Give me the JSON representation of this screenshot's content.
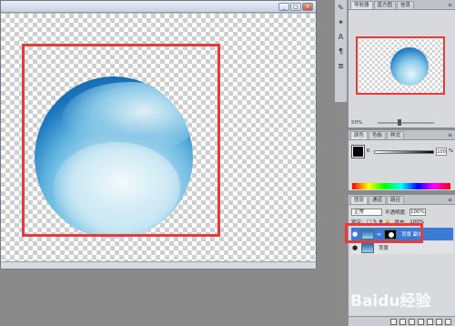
{
  "document": {
    "window_buttons": {
      "minimize": "_",
      "restore": "□",
      "close": "×"
    }
  },
  "tool_icons": [
    "brush-icon",
    "wand-icon",
    "text-icon",
    "paragraph-icon",
    "layers-small-icon"
  ],
  "navigator_panel": {
    "tabs": [
      "导航器",
      "直方图",
      "信息"
    ],
    "zoom": "50%"
  },
  "color_panel": {
    "tabs": [
      "颜色",
      "色板",
      "样式"
    ],
    "channel_label": "K",
    "channel_value": "100",
    "unit": "%"
  },
  "layers_panel": {
    "tabs": [
      "图层",
      "通道",
      "路径"
    ],
    "blend_mode": "正常",
    "opacity_label": "不透明度:",
    "opacity_value": "100%",
    "lock_label": "锁定:",
    "fill_label": "填充:",
    "fill_value": "100%",
    "layers": [
      {
        "name": "背景 副本",
        "selected": true,
        "has_mask": true
      },
      {
        "name": "背景",
        "selected": false,
        "has_mask": false
      }
    ]
  },
  "watermark_text": "Baidu经验",
  "colors": {
    "highlight": "#e63b3b",
    "selection": "#3b7bd6"
  }
}
